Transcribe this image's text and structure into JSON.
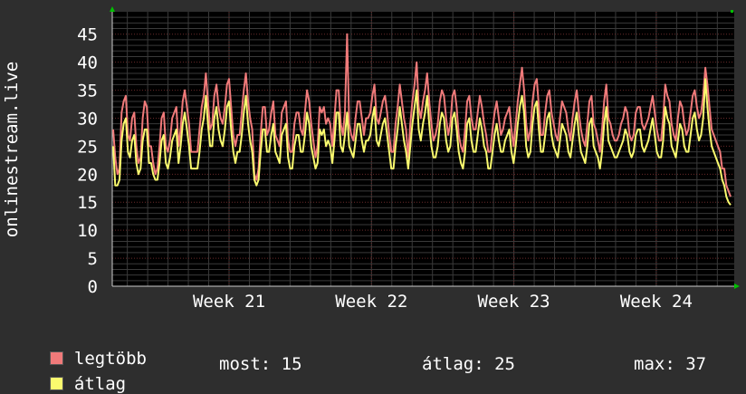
{
  "chart_data": {
    "type": "line",
    "ylabel": "onlinestream.live",
    "yticks": [
      0,
      5,
      10,
      15,
      20,
      25,
      30,
      35,
      40,
      45
    ],
    "ylim": [
      0,
      49
    ],
    "xticks": [
      "Week 21",
      "Week 22",
      "Week 23",
      "Week 24"
    ],
    "grid": true,
    "series": [
      {
        "name": "legtöbb",
        "color": "#f07a7a",
        "values": [
          28,
          23,
          20,
          21,
          31,
          33,
          34,
          27,
          26,
          30,
          31,
          25,
          22,
          23,
          30,
          33,
          32,
          25,
          25,
          22,
          20,
          21,
          25,
          30,
          31,
          25,
          24,
          26,
          30,
          31,
          32,
          25,
          28,
          33,
          35,
          32,
          29,
          24,
          24,
          24,
          24,
          28,
          32,
          34,
          38,
          33,
          28,
          29,
          34,
          36,
          32,
          30,
          29,
          32,
          36,
          37,
          32,
          27,
          25,
          27,
          27,
          31,
          35,
          38,
          33,
          30,
          28,
          20,
          19,
          21,
          27,
          32,
          32,
          27,
          28,
          31,
          33,
          27,
          26,
          25,
          31,
          32,
          33,
          26,
          24,
          24,
          29,
          31,
          31,
          28,
          27,
          31,
          35,
          33,
          29,
          26,
          23,
          25,
          32,
          31,
          32,
          29,
          30,
          29,
          25,
          30,
          35,
          35,
          29,
          27,
          31,
          45,
          29,
          27,
          26,
          30,
          33,
          33,
          30,
          27,
          30,
          30,
          31,
          34,
          36,
          30,
          29,
          31,
          33,
          34,
          31,
          27,
          24,
          24,
          29,
          32,
          36,
          33,
          30,
          28,
          23,
          29,
          33,
          36,
          40,
          32,
          30,
          33,
          35,
          38,
          33,
          29,
          26,
          27,
          29,
          33,
          35,
          34,
          30,
          27,
          29,
          34,
          35,
          32,
          27,
          25,
          24,
          28,
          33,
          34,
          30,
          28,
          28,
          31,
          34,
          32,
          29,
          27,
          24,
          24,
          28,
          31,
          33,
          30,
          27,
          28,
          30,
          31,
          32,
          28,
          25,
          29,
          33,
          36,
          39,
          35,
          29,
          26,
          28,
          33,
          36,
          37,
          32,
          27,
          27,
          31,
          34,
          35,
          31,
          29,
          27,
          26,
          30,
          33,
          32,
          31,
          28,
          26,
          30,
          33,
          35,
          31,
          28,
          26,
          25,
          29,
          33,
          34,
          29,
          28,
          26,
          24,
          28,
          33,
          36,
          30,
          29,
          27,
          26,
          26,
          27,
          29,
          30,
          32,
          31,
          27,
          26,
          27,
          31,
          32,
          32,
          29,
          28,
          29,
          30,
          32,
          34,
          31,
          28,
          26,
          26,
          30,
          36,
          34,
          33,
          29,
          27,
          26,
          30,
          33,
          32,
          29,
          27,
          28,
          31,
          34,
          35,
          32,
          30,
          31,
          34,
          39,
          36,
          32,
          28,
          27,
          26,
          25,
          24,
          21,
          21,
          18,
          17,
          16
        ],
        "stat_label": "most: 15"
      },
      {
        "name": "átlag",
        "color": "#fafa6e",
        "values": [
          25,
          18,
          18,
          19,
          26,
          29,
          30,
          24,
          23,
          26,
          27,
          22,
          20,
          21,
          26,
          28,
          28,
          22,
          22,
          20,
          19,
          19,
          22,
          26,
          27,
          22,
          21,
          23,
          26,
          27,
          28,
          22,
          25,
          29,
          31,
          28,
          25,
          21,
          21,
          21,
          21,
          24,
          28,
          30,
          34,
          29,
          25,
          25,
          30,
          32,
          28,
          26,
          25,
          28,
          32,
          33,
          28,
          24,
          22,
          24,
          24,
          27,
          31,
          34,
          29,
          26,
          24,
          19,
          18,
          19,
          24,
          28,
          28,
          24,
          24,
          27,
          29,
          24,
          23,
          22,
          27,
          28,
          29,
          23,
          21,
          21,
          25,
          27,
          27,
          24,
          24,
          27,
          31,
          29,
          25,
          23,
          21,
          22,
          28,
          27,
          28,
          25,
          26,
          25,
          22,
          26,
          31,
          31,
          25,
          24,
          27,
          31,
          25,
          24,
          23,
          26,
          29,
          29,
          26,
          24,
          26,
          26,
          27,
          30,
          32,
          26,
          25,
          27,
          29,
          30,
          27,
          24,
          21,
          21,
          25,
          28,
          32,
          29,
          26,
          24,
          21,
          25,
          29,
          32,
          35,
          28,
          26,
          29,
          31,
          34,
          29,
          25,
          23,
          23,
          25,
          29,
          31,
          30,
          26,
          24,
          25,
          30,
          31,
          28,
          24,
          22,
          21,
          24,
          29,
          30,
          26,
          24,
          24,
          27,
          30,
          28,
          25,
          24,
          21,
          21,
          24,
          27,
          29,
          26,
          24,
          24,
          26,
          27,
          28,
          24,
          22,
          25,
          29,
          32,
          34,
          31,
          25,
          23,
          24,
          29,
          32,
          33,
          28,
          24,
          24,
          27,
          30,
          31,
          27,
          25,
          24,
          23,
          26,
          29,
          28,
          27,
          24,
          23,
          26,
          29,
          31,
          27,
          24,
          23,
          22,
          25,
          29,
          30,
          25,
          24,
          23,
          21,
          24,
          29,
          32,
          26,
          25,
          24,
          23,
          23,
          24,
          25,
          26,
          28,
          27,
          24,
          23,
          24,
          27,
          28,
          28,
          25,
          24,
          25,
          26,
          28,
          30,
          27,
          24,
          23,
          23,
          26,
          32,
          30,
          29,
          25,
          24,
          23,
          26,
          29,
          28,
          25,
          24,
          24,
          27,
          30,
          31,
          28,
          26,
          27,
          30,
          37,
          32,
          28,
          25,
          24,
          23,
          22,
          21,
          19,
          18,
          16,
          15,
          14.5
        ],
        "stat_label": "átlag: 25"
      }
    ]
  },
  "legend": {
    "max_label": "legtöbb",
    "avg_label": "átlag",
    "stat_now": "most: 15",
    "stat_avg": "átlag: 25",
    "stat_max": "max: 37"
  }
}
